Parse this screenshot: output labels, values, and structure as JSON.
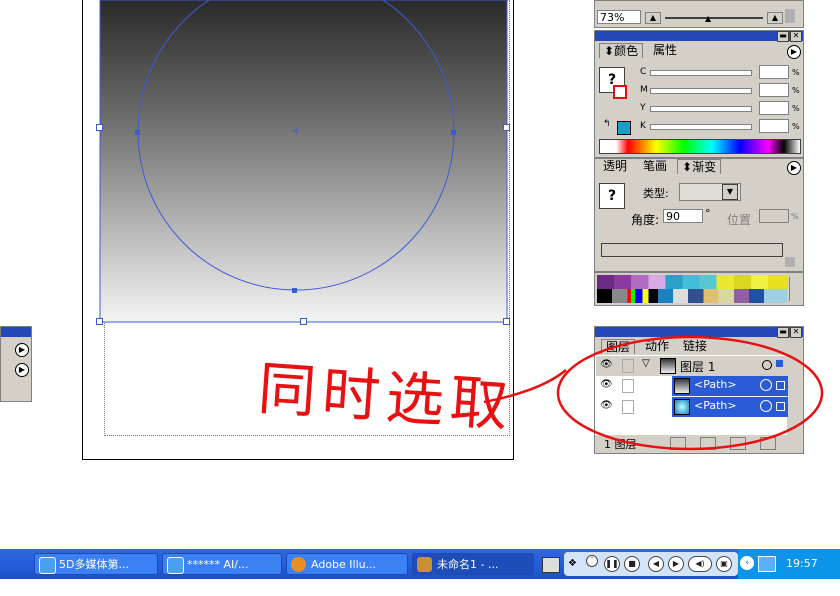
{
  "zoom": "73%",
  "color_panel": {
    "tabs": [
      "颜色",
      "属性"
    ],
    "channels": [
      "C",
      "M",
      "Y",
      "K"
    ],
    "unit": "%"
  },
  "gradient_panel": {
    "tabs": [
      "透明",
      "笔画",
      "渐变"
    ],
    "type_label": "类型:",
    "type_value": "",
    "angle_label": "角度:",
    "angle_value": "90",
    "angle_unit": "°",
    "location_label": "位置",
    "location_unit": "%",
    "help_glyph": "?"
  },
  "layers_panel": {
    "tabs": [
      "图层",
      "动作",
      "链接"
    ],
    "rows": [
      {
        "label": "图层 1",
        "level": 0,
        "selected": false
      },
      {
        "label": "<Path>",
        "level": 1,
        "selected": true
      },
      {
        "label": "<Path>",
        "level": 1,
        "selected": true
      }
    ],
    "footer_count": "1 图层"
  },
  "annotation": {
    "text": "同时选取",
    "color": "#e81010"
  },
  "taskbar": {
    "items": [
      {
        "label": "5D多媒体第..."
      },
      {
        "label": "****** AI/..."
      },
      {
        "label": "Adobe Illu..."
      },
      {
        "label": "未命名1 - ..."
      }
    ],
    "time": "19:57"
  },
  "colors": {
    "selection": "#2a5bd7",
    "panel_bg": "#d4d0c8",
    "title_blue": "#2448b8",
    "path_blue": "#3b5bd6"
  }
}
